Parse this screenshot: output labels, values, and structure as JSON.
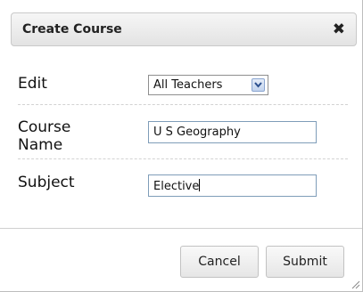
{
  "dialog": {
    "title": "Create Course",
    "close_icon": "close-icon"
  },
  "form": {
    "edit": {
      "label": "Edit",
      "selected": "All Teachers"
    },
    "course_name": {
      "label_line1": "Course",
      "label_line2": "Name",
      "value": "U S Geography"
    },
    "subject": {
      "label": "Subject",
      "value": "Elective"
    }
  },
  "buttons": {
    "cancel_label": "Cancel",
    "submit_label": "Submit"
  }
}
